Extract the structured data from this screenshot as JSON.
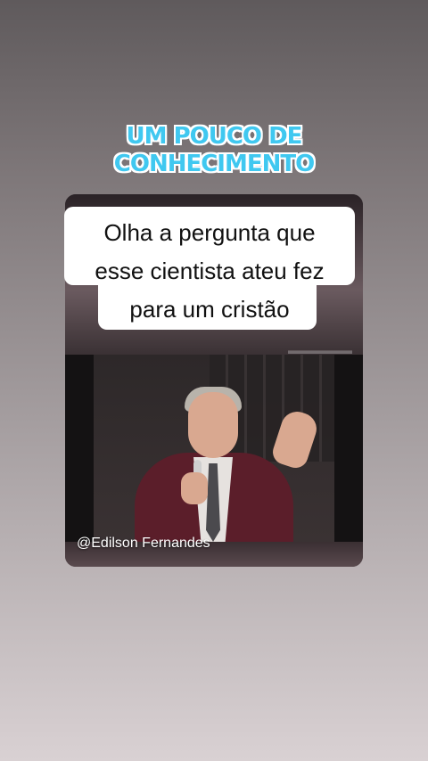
{
  "headline": {
    "line1": "UM POUCO DE",
    "line2": "CONHECIMENTO"
  },
  "question": {
    "line1": "Olha a pergunta que",
    "line2": "esse cientista ateu fez",
    "line3": "para um cristão"
  },
  "video": {
    "handle": "@Edilson Fernandes"
  },
  "colors": {
    "headline_fill": "#40c8f0",
    "headline_outline": "#ffffff",
    "suit": "#5b1e2a"
  }
}
